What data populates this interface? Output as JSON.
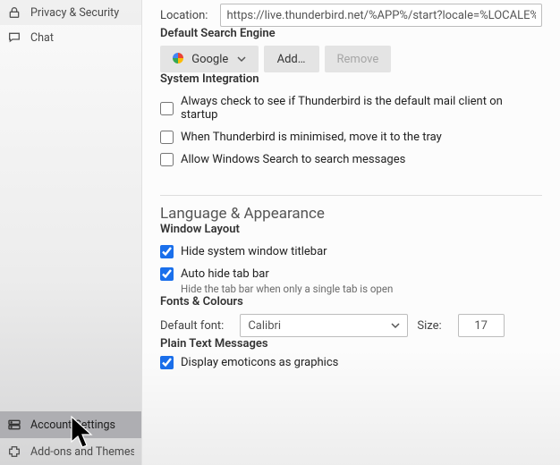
{
  "sidebar": {
    "items": [
      {
        "id": "privacy",
        "label": "Privacy & Security"
      },
      {
        "id": "chat",
        "label": "Chat"
      }
    ],
    "bottom": [
      {
        "id": "account",
        "label": "Account Settings"
      },
      {
        "id": "addons",
        "label": "Add-ons and Themes"
      }
    ]
  },
  "startpage": {
    "location_label": "Location:",
    "location_value": "https://live.thunderbird.net/%APP%/start?locale=%LOCALE%&version=%VERSION%&channel=%CHANNEL%"
  },
  "search": {
    "heading": "Default Search Engine",
    "engine": "Google",
    "add_label": "Add…",
    "remove_label": "Remove"
  },
  "system": {
    "heading": "System Integration",
    "opts": {
      "default_client": {
        "checked": false,
        "label": "Always check to see if Thunderbird is the default mail client on startup"
      },
      "minimise_tray": {
        "checked": false,
        "label": "When Thunderbird is minimised, move it to the tray"
      },
      "windows_search": {
        "checked": false,
        "label": "Allow Windows Search to search messages"
      }
    }
  },
  "lang": {
    "heading": "Language & Appearance"
  },
  "window_layout": {
    "heading": "Window Layout",
    "opts": {
      "hide_titlebar": {
        "checked": true,
        "label": "Hide system window titlebar"
      },
      "auto_hide_tab": {
        "checked": true,
        "label": "Auto hide tab bar",
        "note": "Hide the tab bar when only a single tab is open"
      }
    }
  },
  "fonts": {
    "heading": "Fonts & Colours",
    "font_label": "Default font:",
    "font_value": "Calibri",
    "size_label": "Size:",
    "size_value": "17"
  },
  "plaintext": {
    "heading": "Plain Text Messages",
    "opts": {
      "emoticons": {
        "checked": true,
        "label": "Display emoticons as graphics"
      }
    }
  },
  "colors": {
    "accent": "#1a6feb",
    "panel_bg": "#fcfcfc"
  }
}
